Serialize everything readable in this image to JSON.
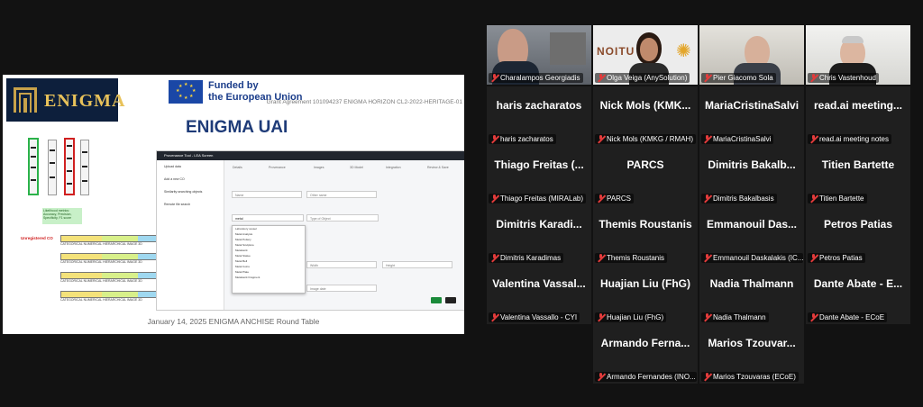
{
  "shared_screen": {
    "logo_text": "ENIGMA",
    "funded_line1": "Funded by",
    "funded_line2": "the European Union",
    "grant": "Grant Agreement 101094237 ENIGMA HORIZON CL2-2022-HERITAGE-01",
    "title": "ENIGMA UAI",
    "footer": "January 14, 2025 ENIGMA ANCHISE Round Table",
    "unregistered_label": "Unregistered CO",
    "metrics_label": "Likelihood metrics: Accuracy, Precision, Specificity, F1 score",
    "bar_caption": "CATEGORICAL   NUMERICAL   HIERARCHICAL   IMAGE   3D",
    "step_numbers": [
      "1",
      "2",
      "3",
      "4"
    ],
    "app_title": "Provenance Tool - LEA Screen",
    "sidebar_items": [
      "Upload data",
      "Add a new CO",
      "Similarity searching objects",
      "Remote file search"
    ],
    "steps": [
      "Details",
      "Provenance",
      "Images",
      "3D Model",
      "Integration",
      "Review & Save"
    ],
    "fields": {
      "name": "Name",
      "other_name": "Other name",
      "search_value": "metal",
      "type_of_object": "Type of Object",
      "width": "Width",
      "height": "Height",
      "type_of_data": "Type of Data",
      "image_date": "Image date"
    },
    "dropdown_items": [
      "Laboratory vessel",
      "Metal Analysis",
      "Metal Pottery",
      "Metal Sculpture",
      "Metalwork",
      "Metal Statue",
      "Metal Bell",
      "Metal Coins",
      "Metal Plate",
      "Metalwork Fragment"
    ]
  },
  "participants": [
    {
      "name": "",
      "label": "Charalampos Georgiadis",
      "video": true,
      "active": true
    },
    {
      "name": "",
      "label": "Olga Veiga (AnySolution)",
      "video": true,
      "active": false,
      "bg_text": "NOITU"
    },
    {
      "name": "",
      "label": "Pier Giacomo Sola",
      "video": true,
      "active": false
    },
    {
      "name": "",
      "label": "Chris Vastenhoud",
      "video": true,
      "active": false
    },
    {
      "name": "haris zacharatos",
      "label": "haris zacharatos"
    },
    {
      "name": "Nick Mols (KMK...",
      "label": "Nick Mols (KMKG / RMAH)"
    },
    {
      "name": "MariaCristinaSalvi",
      "label": "MariaCristinaSalvi"
    },
    {
      "name": "read.ai meeting...",
      "label": "read.ai meeting notes"
    },
    {
      "name": "Thiago Freitas (...",
      "label": "Thiago Freitas (MIRALab)"
    },
    {
      "name": "PARCS",
      "label": "PARCS"
    },
    {
      "name": "Dimitris Bakalb...",
      "label": "Dimitris Bakalbasis"
    },
    {
      "name": "Titien Bartette",
      "label": "Titien Bartette"
    },
    {
      "name": "Dimitris Karadi...",
      "label": "Dimitris Karadimas"
    },
    {
      "name": "Themis Roustanis",
      "label": "Themis Roustanis"
    },
    {
      "name": "Emmanouil Das...",
      "label": "Emmanouil Daskalakis (IC..."
    },
    {
      "name": "Petros Patias",
      "label": "Petros Patias"
    },
    {
      "name": "Valentina Vassal...",
      "label": "Valentina Vassallo - CYI"
    },
    {
      "name": "Huajian Liu (FhG)",
      "label": "Huajian Liu (FhG)"
    },
    {
      "name": "Nadia Thalmann",
      "label": "Nadia Thalmann"
    },
    {
      "name": "Dante Abate - E...",
      "label": "Dante Abate - ECoE"
    },
    {
      "name": "Armando Ferna...",
      "label": "Armando Fernandes (INO..."
    },
    {
      "name": "Marios Tzouvar...",
      "label": "Marios Tzouvaras (ECoE)"
    }
  ],
  "colors": {
    "page_bg": "#121212",
    "tile_bg": "#1f1f1f",
    "active_speaker": "#3bd46a",
    "muted_mic": "#e23b3b",
    "enigma_navy": "#0d1f3c",
    "enigma_gold": "#e8c25a",
    "title_blue": "#1e3b78"
  }
}
